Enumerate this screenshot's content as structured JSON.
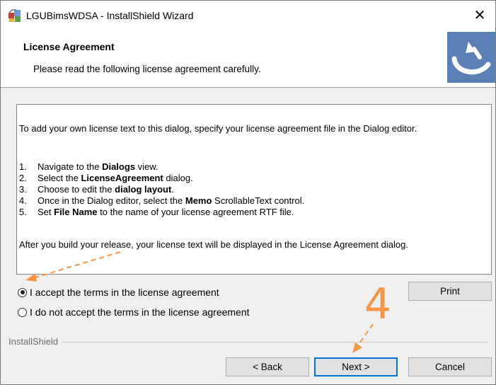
{
  "window": {
    "title": "LGUBimsWDSA - InstallShield Wizard",
    "close_glyph": "✕"
  },
  "header": {
    "title": "License Agreement",
    "subtitle": "Please read the following license agreement carefully.",
    "logo_icon": "installshield-logo-icon"
  },
  "license": {
    "intro": "To add your own license text to this dialog, specify your license agreement file in the Dialog editor.",
    "steps": [
      {
        "num": "1.",
        "pre": "Navigate to the ",
        "bold": "Dialogs",
        "post": " view."
      },
      {
        "num": "2.",
        "pre": "Select the ",
        "bold": "LicenseAgreement",
        "post": " dialog."
      },
      {
        "num": "3.",
        "pre": "Choose to edit the ",
        "bold": "dialog layout",
        "post": "."
      },
      {
        "num": "4.",
        "pre": "Once in the Dialog editor, select the ",
        "bold": "Memo",
        "post": " ScrollableText control."
      },
      {
        "num": "5.",
        "pre": "Set ",
        "bold": "File Name",
        "post": " to the name of your license agreement RTF file."
      }
    ],
    "closing": "After you build your release, your license text will be displayed in the License Agreement dialog."
  },
  "options": {
    "accept_label": "I accept the terms in the license agreement",
    "decline_label": "I do not accept the terms in the license agreement",
    "selected": "accept"
  },
  "buttons": {
    "print": "Print",
    "back": "< Back",
    "next": "Next >",
    "cancel": "Cancel"
  },
  "footer": {
    "group_label": "InstallShield"
  },
  "annotation": {
    "step_number": "4",
    "color": "#f79646"
  }
}
